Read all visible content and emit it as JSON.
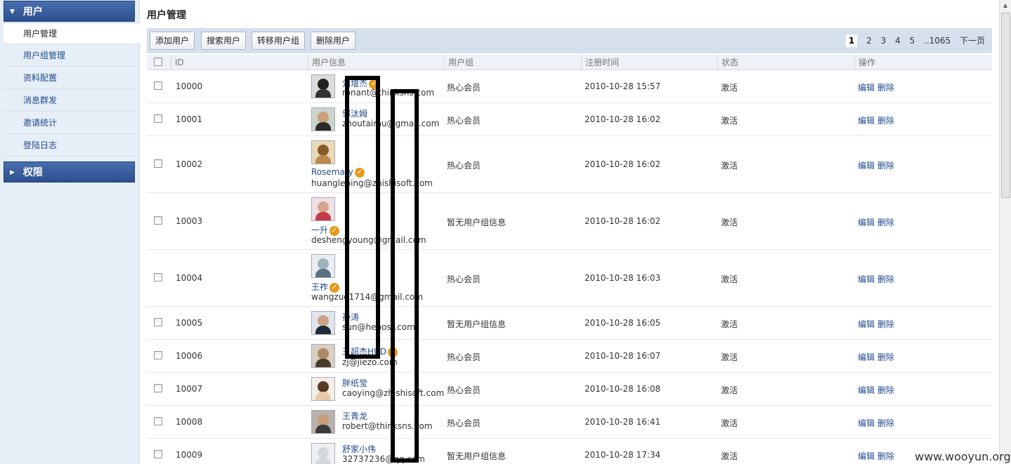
{
  "sidebar": {
    "sections": [
      {
        "title": "用户",
        "caret": "▼"
      },
      {
        "title": "权限",
        "caret": "▶"
      }
    ],
    "items": [
      "用户管理",
      "用户组管理",
      "资料配置",
      "消息群发",
      "邀请统计",
      "登陆日志"
    ]
  },
  "main": {
    "title": "用户管理",
    "toolbar": {
      "buttons": [
        "添加用户",
        "搜索用户",
        "转移用户组",
        "删除用户"
      ],
      "pager": {
        "pages": [
          "1",
          "2",
          "3",
          "4",
          "5",
          "..1065"
        ],
        "next": "下一页",
        "current": "1"
      }
    },
    "columns": [
      "ID",
      "用户信息",
      "用户组",
      "注册时间",
      "状态",
      "操作"
    ],
    "rows": [
      {
        "id": "10000",
        "name": "刘增杰",
        "email": "ronant@thinksns.com",
        "group": "热心会员",
        "reg": "2010-10-28 15:57",
        "status": "激活",
        "edit": "编辑",
        "del": "删除"
      },
      {
        "id": "10001",
        "name": "邹汰姆",
        "email": "zhoutaimu@gmail.com",
        "group": "热心会员",
        "reg": "2010-10-28 16:02",
        "status": "激活",
        "edit": "编辑",
        "del": "删除"
      },
      {
        "id": "10002",
        "name": "Rosemary",
        "email": "huangleping@zhishisoft.com",
        "group": "热心会员",
        "reg": "2010-10-28 16:02",
        "status": "激活",
        "edit": "编辑",
        "del": "删除"
      },
      {
        "id": "10003",
        "name": "一升",
        "email": "deshengyoung@gmail.com",
        "group": "暂无用户组信息",
        "reg": "2010-10-28 16:02",
        "status": "激活",
        "edit": "编辑",
        "del": "删除"
      },
      {
        "id": "10004",
        "name": "王祚",
        "email": "wangzuo1714@gmail.com",
        "group": "热心会员",
        "reg": "2010-10-28 16:03",
        "status": "激活",
        "edit": "编辑",
        "del": "删除"
      },
      {
        "id": "10005",
        "name": "孙涛",
        "email": "sun@hebost.com",
        "group": "暂无用户组信息",
        "reg": "2010-10-28 16:05",
        "status": "激活",
        "edit": "编辑",
        "del": "删除"
      },
      {
        "id": "10006",
        "name": "王超杰HUD",
        "email": "zj@jiezo.com",
        "group": "热心会员",
        "reg": "2010-10-28 16:07",
        "status": "激活",
        "edit": "编辑",
        "del": "删除"
      },
      {
        "id": "10007",
        "name": "胖纸莹",
        "email": "caoying@zhishisoft.com",
        "group": "热心会员",
        "reg": "2010-10-28 16:08",
        "status": "激活",
        "edit": "编辑",
        "del": "删除"
      },
      {
        "id": "10008",
        "name": "王青龙",
        "email": "robert@thinksns.com",
        "group": "热心会员",
        "reg": "2010-10-28 16:41",
        "status": "激活",
        "edit": "编辑",
        "del": "删除"
      },
      {
        "id": "10009",
        "name": "舒家小伟",
        "email": "32737236@qq.com",
        "group": "暂无用户组信息",
        "reg": "2010-10-28 17:34",
        "status": "激活",
        "edit": "编辑",
        "del": "删除"
      }
    ]
  },
  "icons": {
    "verified_badge": "check-badge-icon",
    "scroll_up": "arrow-up-icon"
  },
  "colors": {
    "sidebar_header": "#2c4f8f",
    "toolbar_bg": "#d6e0ed",
    "link": "#224b8c",
    "badge": "#e69a1c"
  },
  "watermark": "www.wooyun.org"
}
